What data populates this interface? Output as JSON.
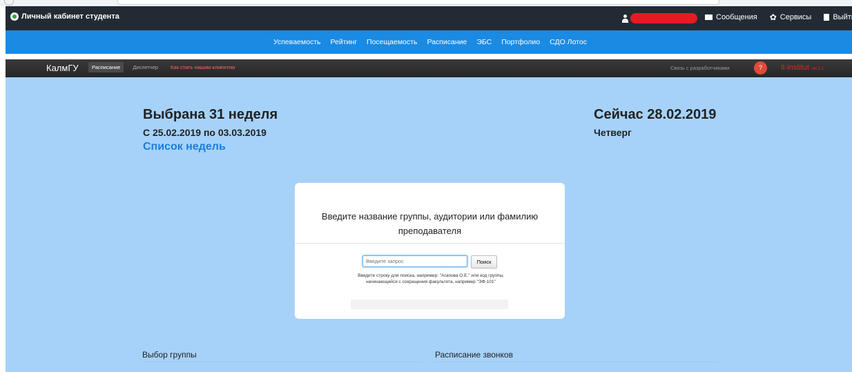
{
  "topbar": {
    "brand": "Личный кабинет студента",
    "links": [
      {
        "label": "Сообщения",
        "icon": "envelope-icon"
      },
      {
        "label": "Сервисы",
        "icon": "gear-icon"
      },
      {
        "label": "Выйти",
        "icon": "exit-icon"
      }
    ]
  },
  "nav": {
    "items": [
      "Успеваемость",
      "Рейтинг",
      "Посещаемость",
      "Расписание",
      "ЭБС",
      "Портфолио",
      "СДО Лотос"
    ]
  },
  "darkbar": {
    "brand": "КалмГУ",
    "tabs": [
      "Расписание",
      "Диспетчер",
      "Как стать нашим клиентом"
    ],
    "dev_link": "Связь с разработчиками",
    "help": "?",
    "it_brand": "it-institut",
    "version": "ver.2.1"
  },
  "week": {
    "title": "Выбрана 31 неделя",
    "range": "С 25.02.2019 по 03.03.2019",
    "list_link": "Список недель"
  },
  "now": {
    "date": "Сейчас 28.02.2019",
    "day": "Четверг"
  },
  "search": {
    "heading_line1": "Введите название группы, аудитории или фамилию",
    "heading_line2": "преподавателя",
    "placeholder": "Введите запрос",
    "button": "Поиск",
    "hint_line1": "Введите строку для поиска, например: \"Агапова О.Е.\" или код группы,",
    "hint_line2": "начинающийся с сокращения факультета, например \"ЭФ-101\""
  },
  "sections": {
    "group_choice": "Выбор группы",
    "bell_schedule": "Расписание звонков"
  },
  "colors": {
    "topbar": "#222b33",
    "nav": "#1a8ae3",
    "main_bg": "#a6d2fa",
    "accent_link": "#1a7ee0",
    "brand_red": "#e0262a"
  }
}
